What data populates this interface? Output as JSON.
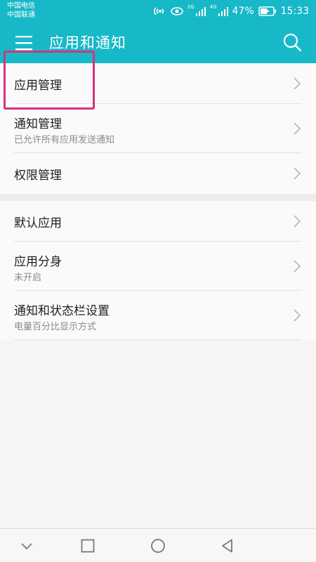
{
  "status_bar": {
    "carrier_1": "中国电信",
    "carrier_2": "中国联通",
    "network_1": "2G",
    "network_2": "4G",
    "battery": "47%",
    "time": "15:33"
  },
  "app_bar": {
    "title": "应用和通知",
    "menu_icon": "hamburger-menu-icon",
    "search_icon": "search-icon"
  },
  "settings": {
    "group_1": [
      {
        "title": "应用管理",
        "subtitle": ""
      },
      {
        "title": "通知管理",
        "subtitle": "已允许所有应用发送通知"
      },
      {
        "title": "权限管理",
        "subtitle": ""
      }
    ],
    "group_2": [
      {
        "title": "默认应用",
        "subtitle": ""
      },
      {
        "title": "应用分身",
        "subtitle": "未开启"
      },
      {
        "title": "通知和状态栏设置",
        "subtitle": "电量百分比显示方式"
      }
    ]
  },
  "nav_bar": [
    "chevron-down-icon",
    "recents-square-icon",
    "home-circle-icon",
    "back-triangle-icon"
  ],
  "colors": {
    "accent": "#17b8c8",
    "highlight": "#d6337b",
    "background": "#f5f5f5"
  }
}
